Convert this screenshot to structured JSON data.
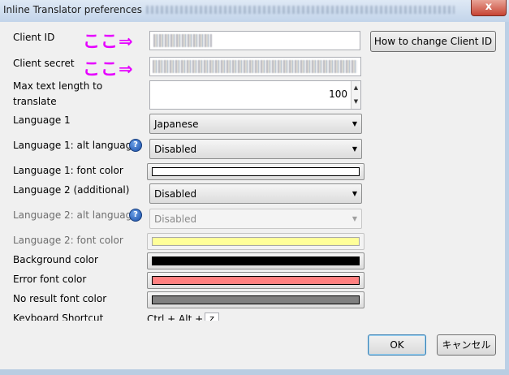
{
  "window": {
    "title": "Inline Translator preferences",
    "close_label": "x"
  },
  "annotation": {
    "text": "ここ⇒"
  },
  "fields": {
    "client_id": {
      "label": "Client ID"
    },
    "client_secret": {
      "label": "Client secret"
    },
    "max_text": {
      "label_line1": "Max text length to",
      "label_line2": "translate",
      "value": "100"
    },
    "language1": {
      "label": "Language 1",
      "value": "Japanese"
    },
    "language1_alt": {
      "label": "Language 1: alt languag",
      "value": "Disabled"
    },
    "language1_font_color": {
      "label": "Language 1: font color",
      "color": "#ffffff"
    },
    "language2": {
      "label": "Language 2 (additional)",
      "value": "Disabled"
    },
    "language2_alt": {
      "label": "Language 2: alt languag",
      "value": "Disabled"
    },
    "language2_font_color": {
      "label": "Language 2: font color",
      "color": "#ffff99"
    },
    "background_color": {
      "label": "Background color",
      "color": "#000000"
    },
    "error_font_color": {
      "label": "Error font color",
      "color": "#ff8080"
    },
    "no_result_font_color": {
      "label": "No result font color",
      "color": "#808080"
    },
    "keyboard_shortcut": {
      "label": "Keyboard Shortcut",
      "prefix": "Ctrl + Alt +",
      "key": "z"
    }
  },
  "buttons": {
    "how_to_change": "How to change Client ID",
    "ok": "OK",
    "cancel": "キャンセル"
  },
  "icons": {
    "help": "?",
    "dropdown": "▼",
    "spin_up": "▲",
    "spin_down": "▼"
  }
}
